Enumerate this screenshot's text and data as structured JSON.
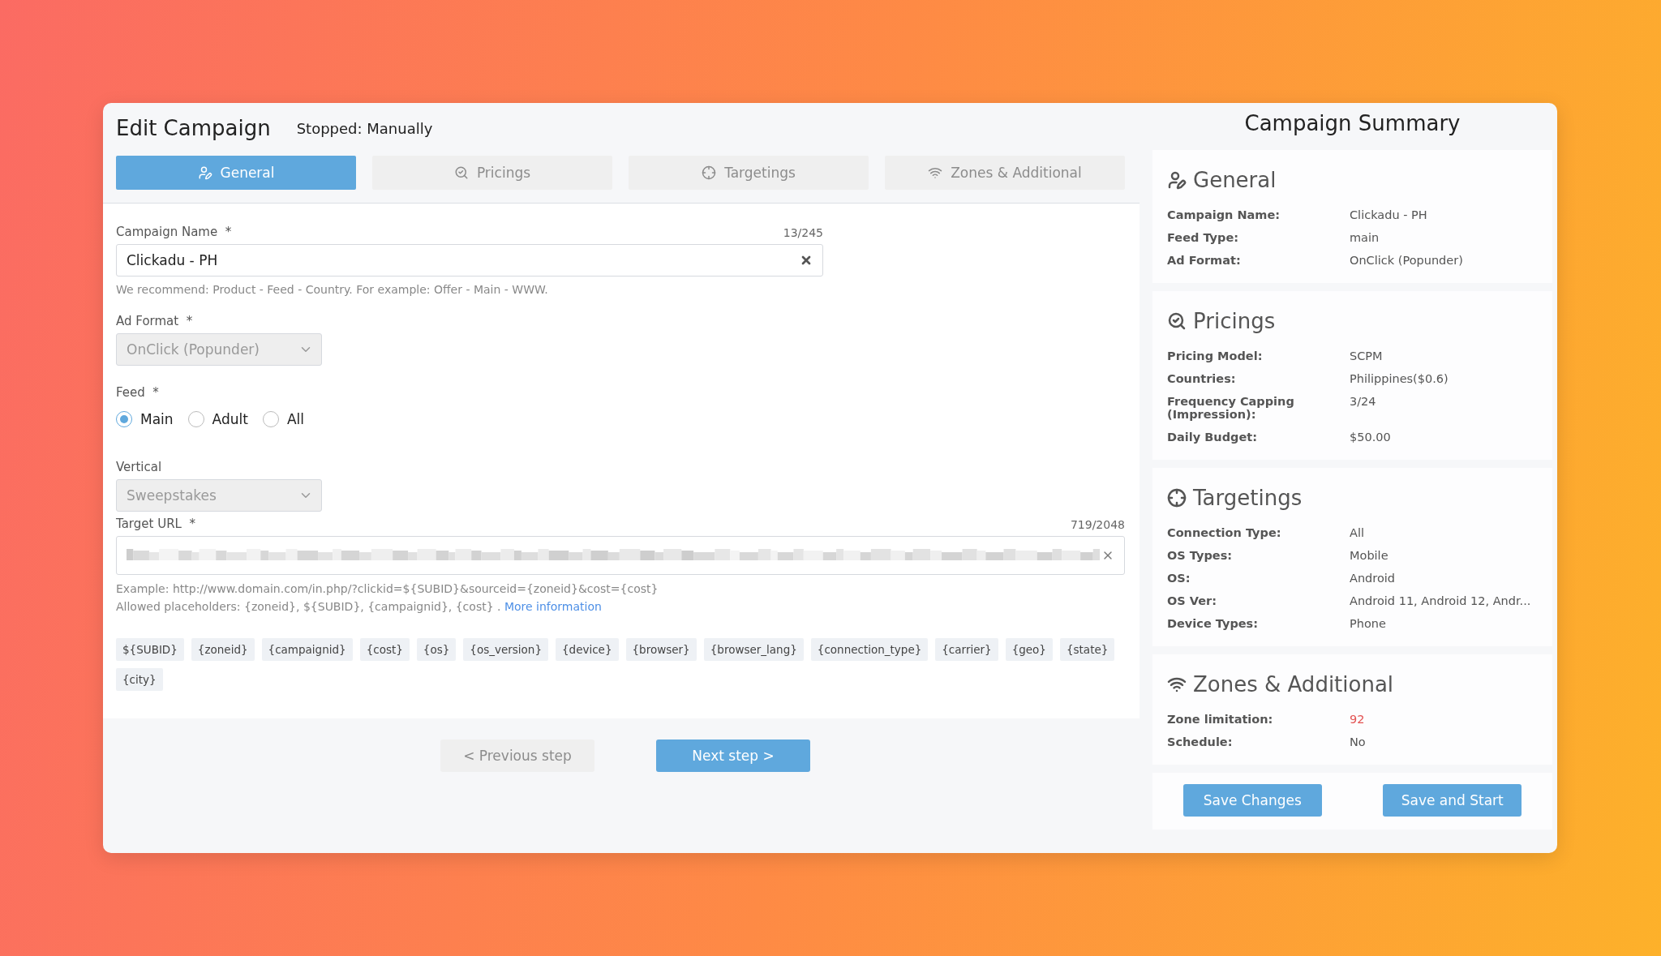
{
  "header": {
    "title": "Edit Campaign",
    "status": "Stopped: Manually"
  },
  "tabs": [
    {
      "label": "General",
      "selected": true
    },
    {
      "label": "Pricings",
      "selected": false
    },
    {
      "label": "Targetings",
      "selected": false
    },
    {
      "label": "Zones & Additional",
      "selected": false
    }
  ],
  "campaign_name": {
    "label": "Campaign Name",
    "required": "*",
    "counter": "13/245",
    "value": "Clickadu - PH",
    "hint": "We recommend: Product - Feed - Country. For example: Offer - Main - WWW."
  },
  "ad_format": {
    "label": "Ad Format",
    "required": "*",
    "value": "OnClick (Popunder)",
    "disabled": true
  },
  "feed": {
    "label": "Feed",
    "required": "*",
    "options": [
      {
        "label": "Main",
        "selected": true
      },
      {
        "label": "Adult",
        "selected": false
      },
      {
        "label": "All",
        "selected": false
      }
    ]
  },
  "vertical": {
    "label": "Vertical",
    "value": "Sweepstakes",
    "disabled": true
  },
  "target_url": {
    "label": "Target URL",
    "required": "*",
    "counter": "719/2048",
    "example": "Example: http://www.domain.com/in.php/?clickid=${SUBID}&sourceid={zoneid}&cost={cost}",
    "allowed": "Allowed placeholders: {zoneid}, ${SUBID}, {campaignid}, {cost} .",
    "link": "More information"
  },
  "placeholders": [
    "${SUBID}",
    "{zoneid}",
    "{campaignid}",
    "{cost}",
    "{os}",
    "{os_version}",
    "{device}",
    "{browser}",
    "{browser_lang}",
    "{connection_type}",
    "{carrier}",
    "{geo}",
    "{state}",
    "{city}"
  ],
  "steps": [
    {
      "label": "< Previous step",
      "disabled": true
    },
    {
      "label": "Next step >",
      "disabled": false
    }
  ],
  "summary": {
    "title": "Campaign Summary",
    "sections": [
      {
        "title": "General",
        "rows": [
          {
            "label": "Campaign Name:",
            "value": "Clickadu - PH",
            "warning": false
          },
          {
            "label": "Feed Type:",
            "value": "main",
            "warning": false
          },
          {
            "label": "Ad Format:",
            "value": "OnClick (Popunder)",
            "warning": false
          }
        ]
      },
      {
        "title": "Pricings",
        "rows": [
          {
            "label": "Pricing Model:",
            "value": "SCPM",
            "warning": false
          },
          {
            "label": "Countries:",
            "value": "Philippines($0.6)",
            "warning": false
          },
          {
            "label": "Frequency Capping (Impression):",
            "value": "3/24",
            "warning": false
          },
          {
            "label": "Daily Budget:",
            "value": "$50.00",
            "warning": false
          }
        ]
      },
      {
        "title": "Targetings",
        "rows": [
          {
            "label": "Connection Type:",
            "value": "All",
            "warning": false
          },
          {
            "label": "OS Types:",
            "value": "Mobile",
            "warning": false
          },
          {
            "label": "OS:",
            "value": "Android",
            "warning": false
          },
          {
            "label": "OS Ver:",
            "value": "Android 11, Android 12, Andr...",
            "warning": false
          },
          {
            "label": "Device Types:",
            "value": "Phone",
            "warning": false
          }
        ]
      },
      {
        "title": "Zones & Additional",
        "rows": [
          {
            "label": "Zone limitation:",
            "value": "92",
            "warning": true
          },
          {
            "label": "Schedule:",
            "value": "No",
            "warning": false
          }
        ]
      }
    ],
    "buttons": [
      "Save Changes",
      "Save and Start"
    ]
  }
}
